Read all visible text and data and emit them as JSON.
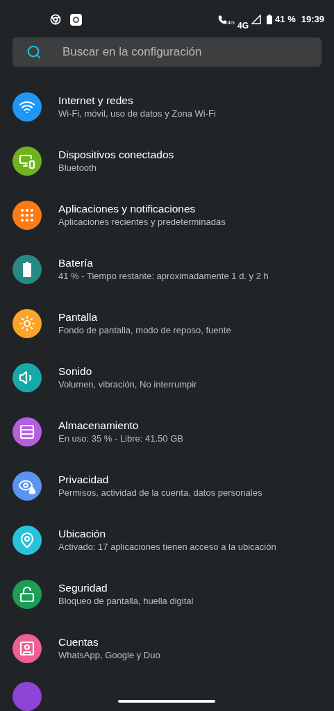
{
  "status_bar": {
    "call_network": "4G",
    "network": "4G",
    "battery": "41 %",
    "time": "19:39"
  },
  "search": {
    "placeholder": "Buscar en la configuración"
  },
  "items": [
    {
      "kind": "wifi",
      "color": "#2196f3",
      "title": "Internet y redes",
      "subtitle": "Wi-Fi, móvil, uso de datos y Zona Wi-Fi"
    },
    {
      "kind": "devices",
      "color": "#6fb31e",
      "title": "Dispositivos conectados",
      "subtitle": "Bluetooth"
    },
    {
      "kind": "apps",
      "color": "#fb7c16",
      "title": "Aplicaciones y notificaciones",
      "subtitle": "Aplicaciones recientes y predeterminadas"
    },
    {
      "kind": "battery",
      "color": "#268a82",
      "title": "Batería",
      "subtitle": "41 % - Tiempo restante: aproximadamente 1 d. y 2 h"
    },
    {
      "kind": "display",
      "color": "#fca32a",
      "title": "Pantalla",
      "subtitle": "Fondo de pantalla, modo de reposo, fuente"
    },
    {
      "kind": "sound",
      "color": "#15aaa8",
      "title": "Sonido",
      "subtitle": "Volumen, vibración, No interrumpir"
    },
    {
      "kind": "storage",
      "color": "#b65ee0",
      "title": "Almacenamiento",
      "subtitle": "En uso: 35 % - Libre: 41.50 GB"
    },
    {
      "kind": "privacy",
      "color": "#5b93f0",
      "title": "Privacidad",
      "subtitle": "Permisos, actividad de la cuenta, datos personales"
    },
    {
      "kind": "location",
      "color": "#26c3da",
      "title": "Ubicación",
      "subtitle": "Activado: 17 aplicaciones tienen acceso a la ubicación"
    },
    {
      "kind": "security",
      "color": "#1c9e55",
      "title": "Seguridad",
      "subtitle": "Bloqueo de pantalla, huella digital"
    },
    {
      "kind": "accounts",
      "color": "#ef5f91",
      "title": "Cuentas",
      "subtitle": "WhatsApp, Google y Duo"
    }
  ]
}
